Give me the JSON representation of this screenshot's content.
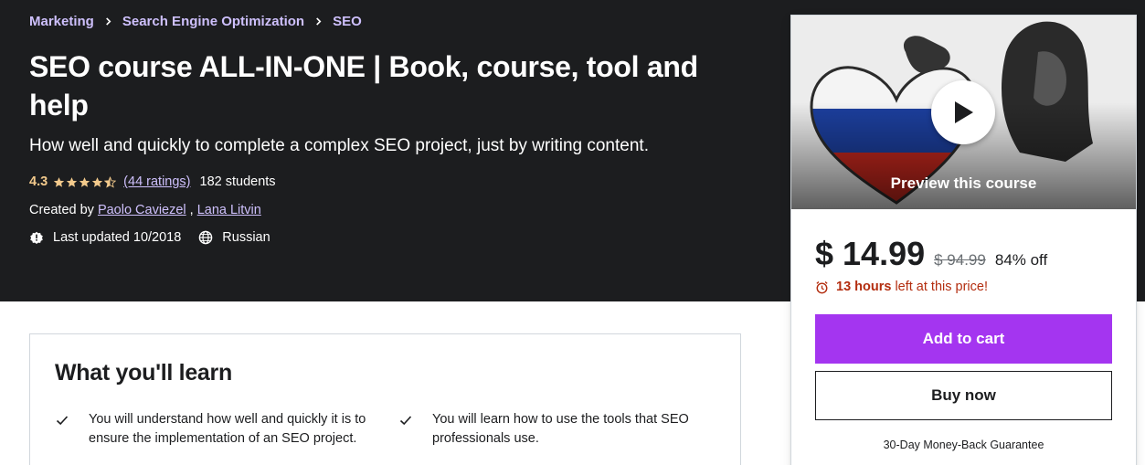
{
  "breadcrumb": [
    "Marketing",
    "Search Engine Optimization",
    "SEO"
  ],
  "course": {
    "title": "SEO course ALL-IN-ONE | Book, course, tool and help",
    "subtitle": "How well and quickly to complete a complex SEO project, just by writing content.",
    "rating": "4.3",
    "rating_value": 4.3,
    "rating_count": "(44 ratings)",
    "students": "182 students",
    "created_by_label": "Created by",
    "authors": [
      "Paolo Caviezel",
      "Lana Litvin"
    ],
    "author_separator": ",",
    "last_updated": "Last updated 10/2018",
    "language": "Russian"
  },
  "sidebar": {
    "preview_label": "Preview this course",
    "price": "$ 14.99",
    "original_price": "$ 94.99",
    "discount": "84% off",
    "timer_hours": "13 hours",
    "timer_text": "left at this price!",
    "add_to_cart": "Add to cart",
    "buy_now": "Buy now",
    "guarantee": "30-Day Money-Back Guarantee"
  },
  "learn": {
    "title": "What you'll learn",
    "items": [
      "You will understand how well and quickly it is to ensure the implementation of an SEO project.",
      "You will learn how to use the tools that SEO professionals use."
    ]
  },
  "colors": {
    "hero_bg": "#1c1d1f",
    "link_purple": "#cec0fc",
    "star_gold": "#f3ca8c",
    "cart_purple": "#a435f0",
    "timer_red": "#b32d0f"
  },
  "icons": [
    "chevron-right-icon",
    "star-icon",
    "half-star-icon",
    "alert-badge-icon",
    "globe-icon",
    "play-icon",
    "alarm-clock-icon",
    "check-icon"
  ]
}
